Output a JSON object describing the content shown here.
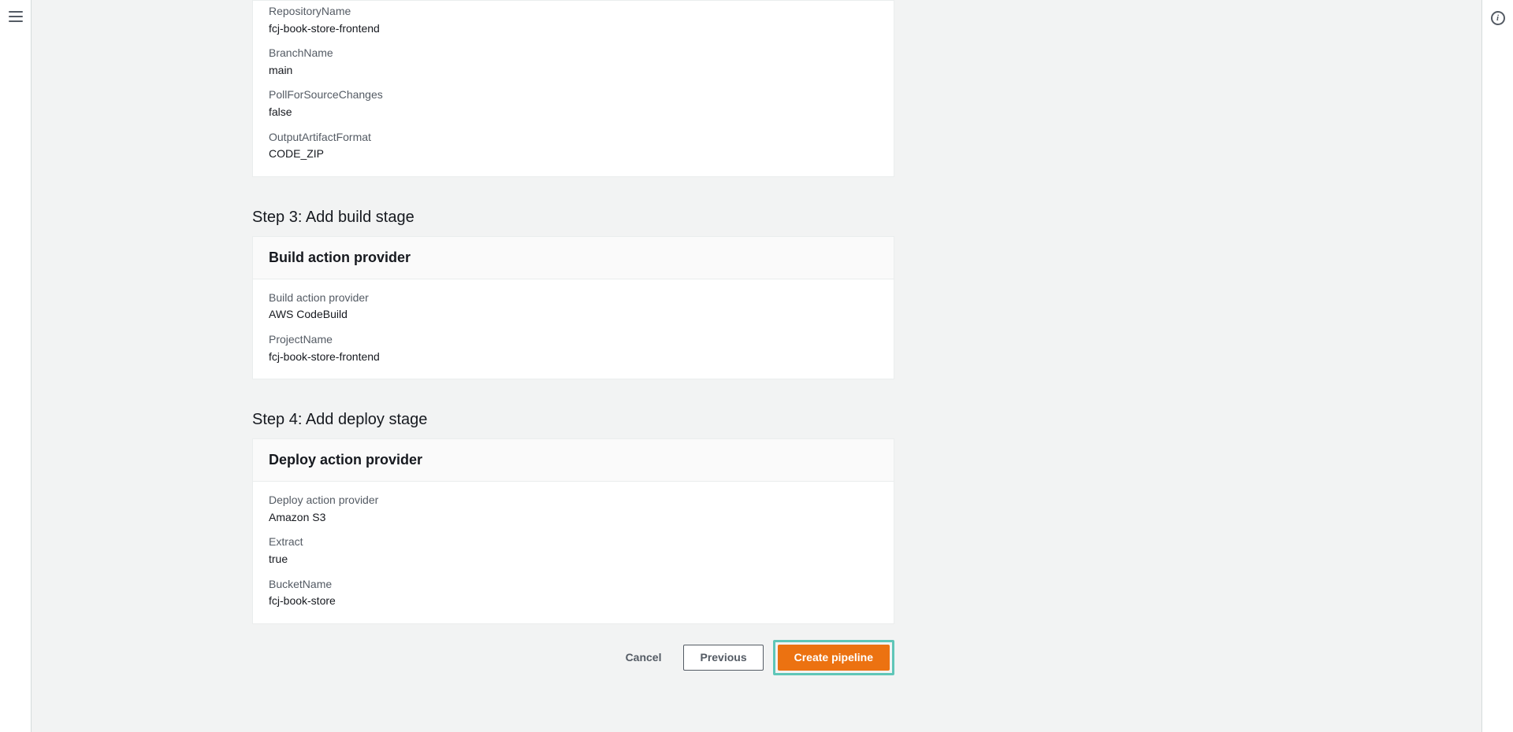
{
  "source": {
    "fields": [
      {
        "label": "RepositoryName",
        "value": "fcj-book-store-frontend"
      },
      {
        "label": "BranchName",
        "value": "main"
      },
      {
        "label": "PollForSourceChanges",
        "value": "false"
      },
      {
        "label": "OutputArtifactFormat",
        "value": "CODE_ZIP"
      }
    ]
  },
  "step3": {
    "title": "Step 3: Add build stage",
    "panel_title": "Build action provider",
    "fields": [
      {
        "label": "Build action provider",
        "value": "AWS CodeBuild"
      },
      {
        "label": "ProjectName",
        "value": "fcj-book-store-frontend"
      }
    ]
  },
  "step4": {
    "title": "Step 4: Add deploy stage",
    "panel_title": "Deploy action provider",
    "fields": [
      {
        "label": "Deploy action provider",
        "value": "Amazon S3"
      },
      {
        "label": "Extract",
        "value": "true"
      },
      {
        "label": "BucketName",
        "value": "fcj-book-store"
      }
    ]
  },
  "buttons": {
    "cancel": "Cancel",
    "previous": "Previous",
    "create": "Create pipeline"
  }
}
